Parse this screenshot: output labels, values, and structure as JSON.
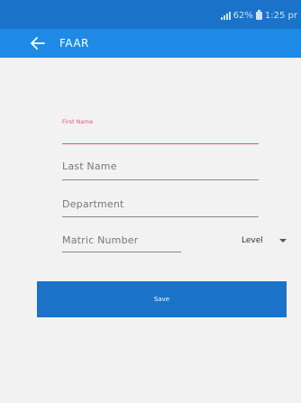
{
  "status_bar": {
    "battery_text": "62%",
    "time": "1:25 pr"
  },
  "app_bar": {
    "title": "FAAR",
    "back_icon": "arrow-left-icon"
  },
  "form": {
    "first_name_label": "First Name",
    "last_name_label": "Last Name",
    "department_label": "Department",
    "matric_label": "Matric Number",
    "level_label": "Level",
    "save_label": "Save"
  },
  "colors": {
    "status_bar": "#1a73c9",
    "app_bar": "#1e8ae6",
    "accent_focus": "#e4496f",
    "button": "#1a73c9",
    "background": "#f2f2f2"
  }
}
